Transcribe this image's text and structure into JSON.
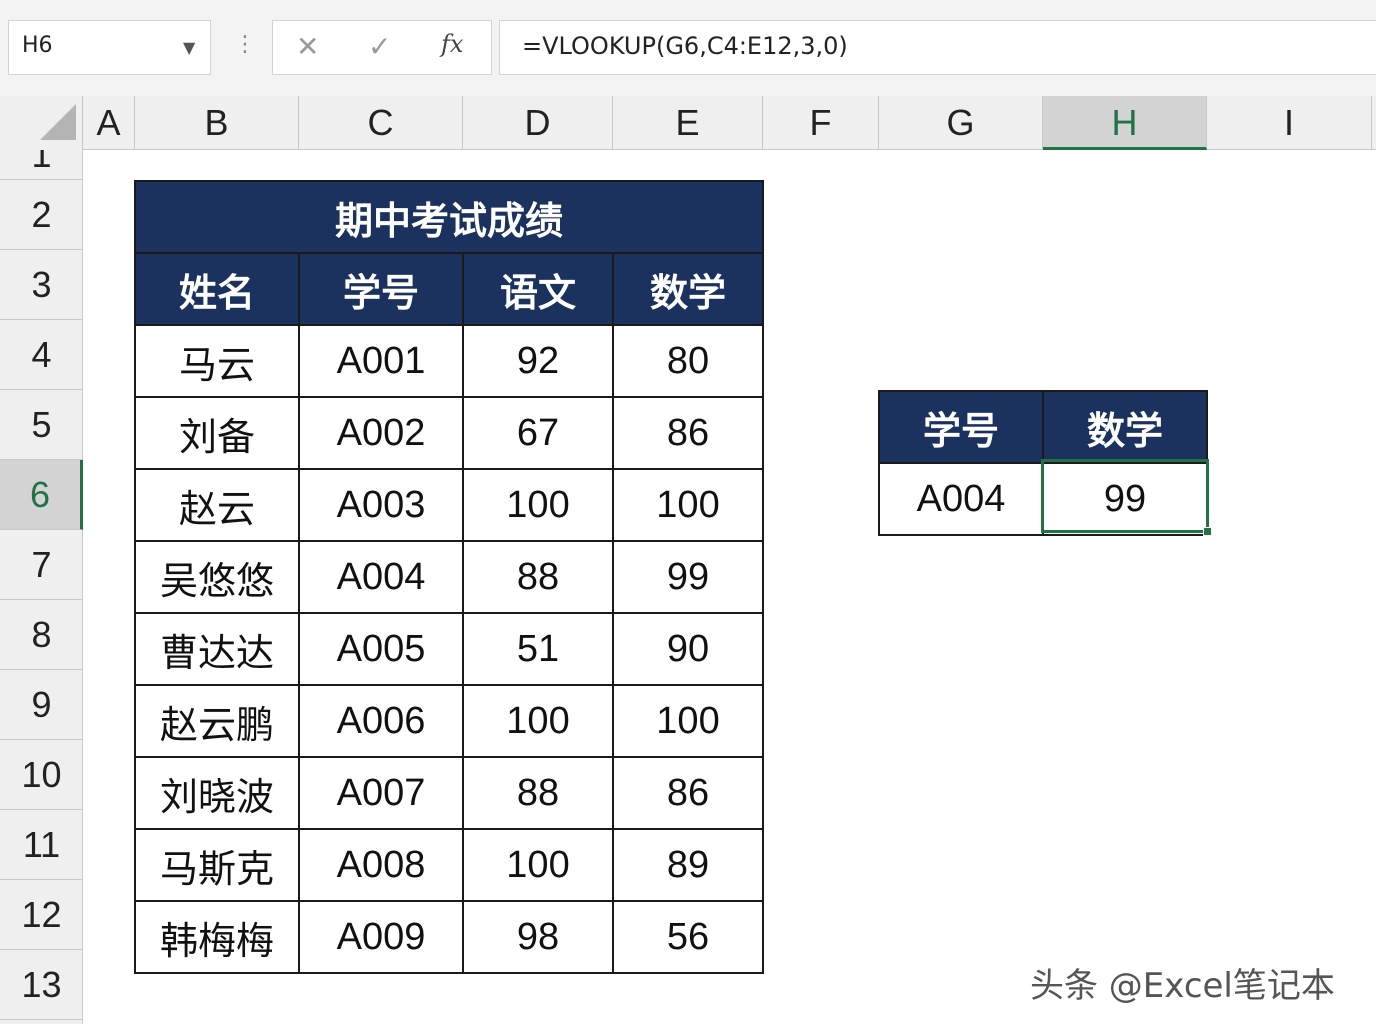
{
  "formula_bar": {
    "name_box": "H6",
    "grip": "⋮",
    "cancel_icon": "✕",
    "confirm_icon": "✓",
    "fx_label": "fx",
    "formula": "=VLOOKUP(G6,C4:E12,3,0)"
  },
  "columns": [
    "A",
    "B",
    "C",
    "D",
    "E",
    "F",
    "G",
    "H",
    "I"
  ],
  "selected_column": "H",
  "rows": [
    "1",
    "2",
    "3",
    "4",
    "5",
    "6",
    "7",
    "8",
    "9",
    "10",
    "11",
    "12",
    "13"
  ],
  "selected_row": "6",
  "main_table": {
    "title": "期中考试成绩",
    "headers": [
      "姓名",
      "学号",
      "语文",
      "数学"
    ],
    "rows": [
      [
        "马云",
        "A001",
        "92",
        "80"
      ],
      [
        "刘备",
        "A002",
        "67",
        "86"
      ],
      [
        "赵云",
        "A003",
        "100",
        "100"
      ],
      [
        "吴悠悠",
        "A004",
        "88",
        "99"
      ],
      [
        "曹达达",
        "A005",
        "51",
        "90"
      ],
      [
        "赵云鹏",
        "A006",
        "100",
        "100"
      ],
      [
        "刘晓波",
        "A007",
        "88",
        "86"
      ],
      [
        "马斯克",
        "A008",
        "100",
        "89"
      ],
      [
        "韩梅梅",
        "A009",
        "98",
        "56"
      ]
    ]
  },
  "lookup_table": {
    "headers": [
      "学号",
      "数学"
    ],
    "row": [
      "A004",
      "99"
    ]
  },
  "watermark": "头条 @Excel笔记本",
  "colors": {
    "header_fill": "#1b325e",
    "selection_green": "#217346"
  }
}
